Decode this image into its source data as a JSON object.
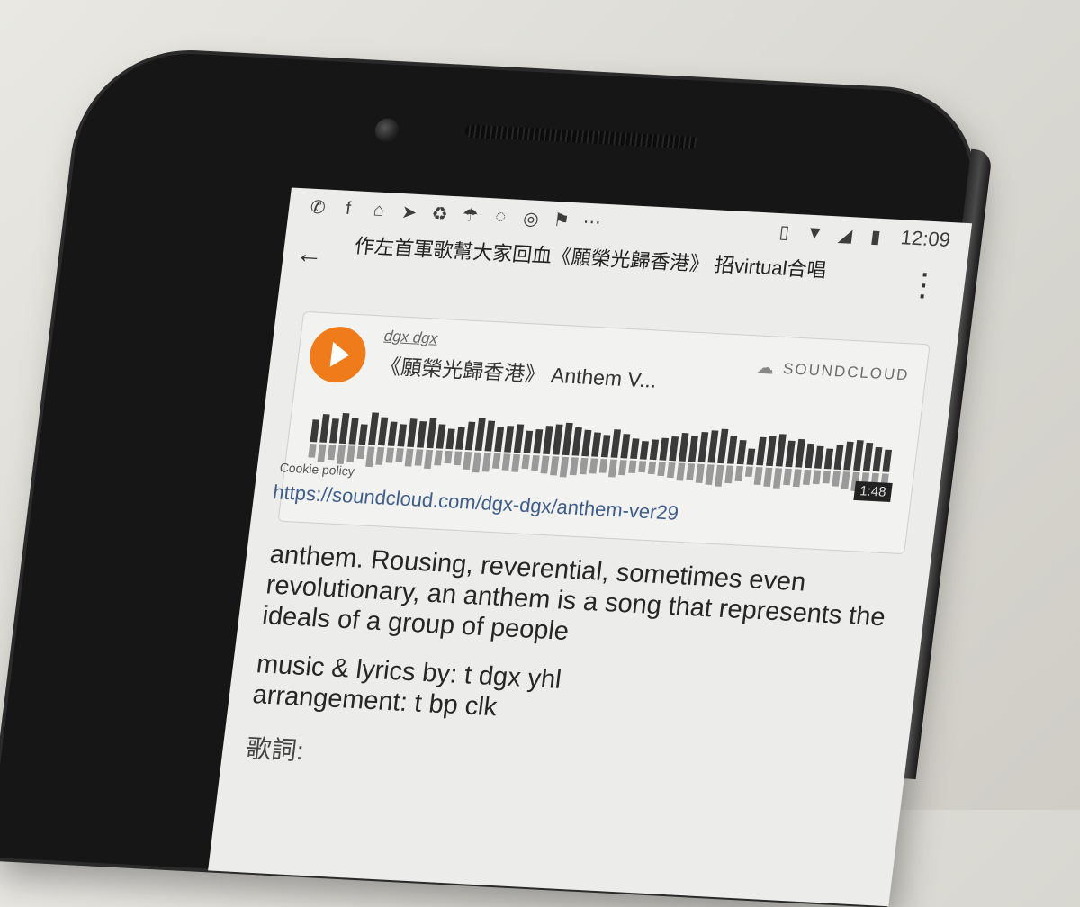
{
  "statusbar": {
    "left_icons": [
      "whatsapp-icon",
      "facebook-icon",
      "home-alert-icon",
      "telegram-icon",
      "sync-icon",
      "weather-icon",
      "messenger-icon",
      "instagram-icon",
      "flag-icon",
      "overflow-dots-icon"
    ],
    "time": "12:09"
  },
  "appbar": {
    "title": "作左首軍歌幫大家回血《願榮光歸香港》 招virtual合唱"
  },
  "embed": {
    "artist": "dgx dgx",
    "track_title": "《願榮光歸香港》 Anthem V...",
    "brand": "SOUNDCLOUD",
    "duration": "1:48",
    "cookie_policy": "Cookie policy"
  },
  "post": {
    "link": "https://soundcloud.com/dgx-dgx/anthem-ver29",
    "paragraph": "anthem. Rousing, reverential, sometimes even revolutionary, an anthem is a song that represents the ideals of a group of people",
    "credit_music": "music & lyrics by: t dgx yhl",
    "credit_arrangement": "arrangement: t bp clk",
    "lyrics_label": "歌詞:"
  },
  "waveform": {
    "peaks": [
      0.55,
      0.7,
      0.6,
      0.75,
      0.65,
      0.5,
      0.8,
      0.7,
      0.6,
      0.55,
      0.7,
      0.65,
      0.75,
      0.6,
      0.5,
      0.55,
      0.7,
      0.8,
      0.75,
      0.6,
      0.65,
      0.7,
      0.55,
      0.6,
      0.7,
      0.75,
      0.8,
      0.7,
      0.65,
      0.6,
      0.55,
      0.7,
      0.6,
      0.5,
      0.45,
      0.5,
      0.55,
      0.6,
      0.7,
      0.65,
      0.75,
      0.8,
      0.85,
      0.7,
      0.6,
      0.4,
      0.7,
      0.75,
      0.8,
      0.65,
      0.7,
      0.6,
      0.55,
      0.5,
      0.6,
      0.7,
      0.75,
      0.7,
      0.6,
      0.55
    ]
  }
}
